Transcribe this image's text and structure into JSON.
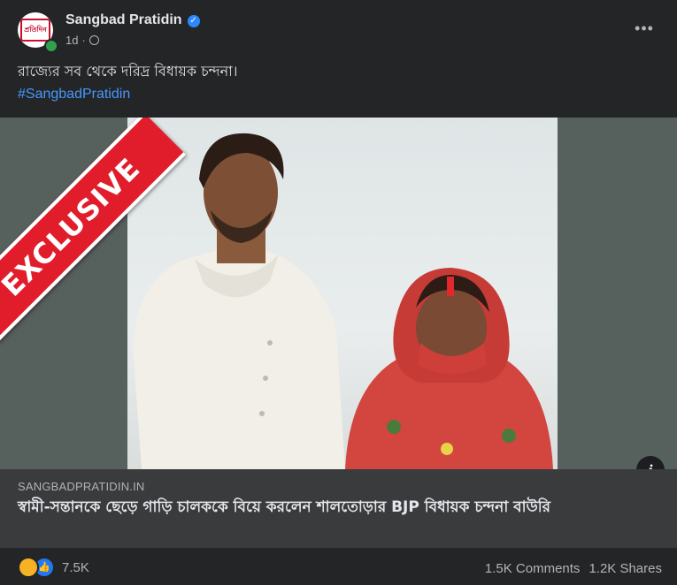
{
  "post": {
    "page_name": "Sangbad Pratidin",
    "avatar_logo": "প্রতিদিন",
    "time": "1d",
    "separator": "·",
    "more_label": "•••",
    "caption": "রাজ্যের সব থেকে দরিদ্র বিধায়ক চন্দনা।",
    "hashtag": "#SangbadPratidin"
  },
  "media": {
    "badge_text": "EXCLUSIVE",
    "info_label": "i"
  },
  "link": {
    "domain": "SANGBADPRATIDIN.IN",
    "title": "স্বামী-সন্তানকে ছেড়ে গাড়ি চালককে বিয়ে করলেন শালতোড়ার BJP বিধায়ক চন্দনা বাউরি"
  },
  "engagement": {
    "reactions": [
      "haha-icon",
      "like-icon"
    ],
    "reaction_count": "7.5K",
    "comments": "1.5K Comments",
    "shares": "1.2K Shares"
  },
  "colors": {
    "background": "#242526",
    "link_bg": "#3a3b3c",
    "hashtag": "#4599ff",
    "ribbon": "#e11d2b",
    "verified": "#2d88ff"
  }
}
